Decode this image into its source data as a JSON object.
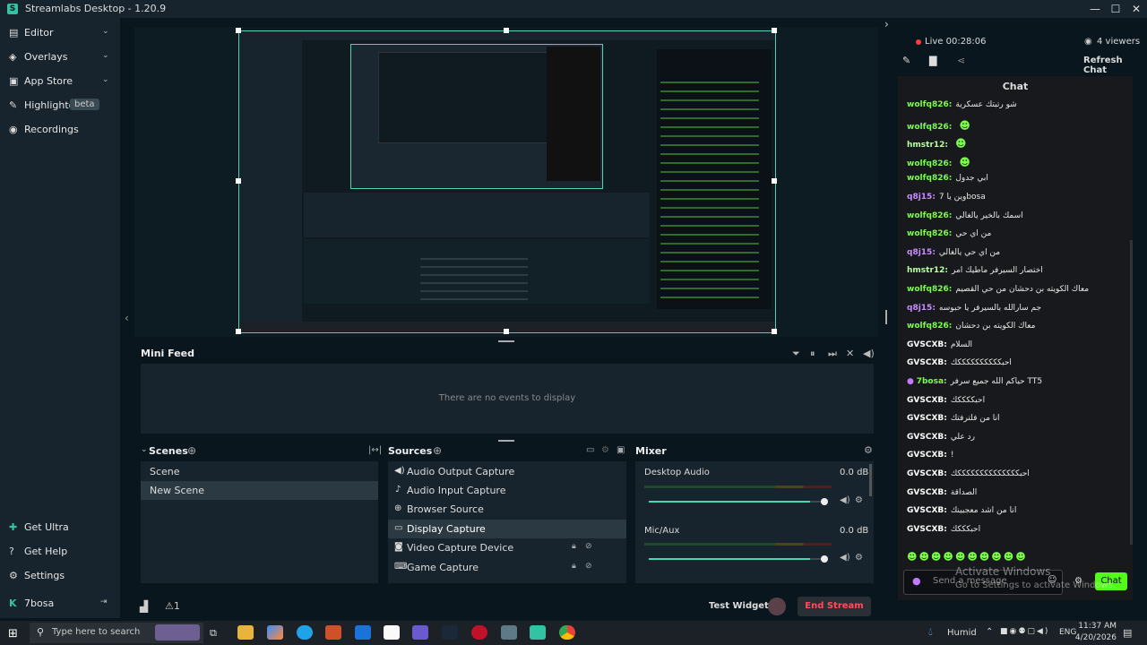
{
  "app": {
    "title": "Streamlabs Desktop - 1.20.9",
    "logo": "streamlabs-logo"
  },
  "window_controls": {
    "minimize": "—",
    "maximize": "☐",
    "close": "✕"
  },
  "sidebar": {
    "items": [
      {
        "label": "Editor",
        "icon": "editor-icon"
      },
      {
        "label": "Overlays",
        "icon": "overlays-icon"
      },
      {
        "label": "App Store",
        "icon": "app-store-icon"
      },
      {
        "label": "Highlighter",
        "icon": "highlighter-icon",
        "badge": "beta"
      },
      {
        "label": "Recordings",
        "icon": "recordings-icon"
      }
    ],
    "bottom": [
      {
        "label": "Get Ultra"
      },
      {
        "label": "Get Help"
      },
      {
        "label": "Settings"
      },
      {
        "label": "7bosa"
      }
    ]
  },
  "mini_feed": {
    "title": "Mini Feed",
    "empty": "There are no events to display"
  },
  "scenes": {
    "title": "Scenes",
    "items": [
      "Scene",
      "New Scene"
    ],
    "selected": "New Scene"
  },
  "sources": {
    "title": "Sources",
    "items": [
      "Audio Output Capture",
      "Audio Input Capture",
      "Browser Source",
      "Display Capture",
      "Video Capture Device",
      "Game Capture"
    ],
    "selected": "Display Capture"
  },
  "mixer": {
    "title": "Mixer",
    "channels": [
      {
        "name": "Desktop Audio",
        "db": "0.0 dB",
        "level": 0.92
      },
      {
        "name": "Mic/Aux",
        "db": "0.0 dB",
        "level": 0.92
      }
    ]
  },
  "footer": {
    "test_widgets": "Test Widgets",
    "end_stream": "End Stream"
  },
  "stream_info": {
    "live": "Live 00:28:06",
    "viewers": "4 viewers",
    "refresh": "Refresh Chat"
  },
  "chat": {
    "title": "Chat",
    "messages": [
      {
        "user": "wolfq826:",
        "text": "شو رتبتك عسكرية",
        "color": "#7cfc4a"
      },
      {
        "user": "wolfq826:",
        "text": "",
        "color": "#7cfc4a",
        "emote": true
      },
      {
        "user": "hmstr12:",
        "text": "",
        "color": "#b7ff9d",
        "emote": true
      },
      {
        "user": "wolfq826:",
        "text": "",
        "color": "#7cfc4a",
        "emote": true
      },
      {
        "user": "wolfq826:",
        "text": "ابي جدول",
        "color": "#7cfc4a"
      },
      {
        "user": "q8j15:",
        "text": "وين يا 7bosa",
        "color": "#c98cff"
      },
      {
        "user": "wolfq826:",
        "text": "اسمك بالخير يالغالي",
        "color": "#7cfc4a"
      },
      {
        "user": "wolfq826:",
        "text": "من اي حي",
        "color": "#7cfc4a"
      },
      {
        "user": "q8j15:",
        "text": "من اي حي يالغالي",
        "color": "#c98cff"
      },
      {
        "user": "hmstr12:",
        "text": "اختصار السيرفر ماطيك امر",
        "color": "#b7ff9d"
      },
      {
        "user": "wolfq826:",
        "text": "معاك الكويته بن دحشان من حي القصيم",
        "color": "#7cfc4a"
      },
      {
        "user": "q8j15:",
        "text": "جم سارالله بالسيرفر يا حبوسه",
        "color": "#c98cff"
      },
      {
        "user": "wolfq826:",
        "text": "معاك الكويته بن دحشان",
        "color": "#7cfc4a"
      },
      {
        "user": "GVSCXB:",
        "text": "السلام",
        "color": "#ffffff"
      },
      {
        "user": "GVSCXB:",
        "text": "احبككككككككككك",
        "color": "#ffffff"
      },
      {
        "user": "7bosa:",
        "text": "حياكم الله جميع سرفر TT5",
        "color": "#7cfc4a",
        "mic": true
      },
      {
        "user": "GVSCXB:",
        "text": "احبككككك",
        "color": "#ffffff"
      },
      {
        "user": "GVSCXB:",
        "text": "انا من فلترفتك",
        "color": "#ffffff"
      },
      {
        "user": "GVSCXB:",
        "text": "رد علي",
        "color": "#ffffff"
      },
      {
        "user": "GVSCXB:",
        "text": "!",
        "color": "#ffffff"
      },
      {
        "user": "GVSCXB:",
        "text": "احبككككككككككككككك",
        "color": "#ffffff"
      },
      {
        "user": "GVSCXB:",
        "text": "الصداقة",
        "color": "#ffffff"
      },
      {
        "user": "GVSCXB:",
        "text": "انا من اشد معجبينك",
        "color": "#ffffff"
      },
      {
        "user": "GVSCXB:",
        "text": "احبكككك",
        "color": "#ffffff"
      }
    ],
    "input_placeholder": "Send a message",
    "send_label": "Chat",
    "activate_title": "Activate Windows",
    "activate_sub": "Go to Settings to activate Windows."
  },
  "taskbar": {
    "search_placeholder": "Type here to search",
    "weather": "Humid",
    "lang": "ENG",
    "time": "11:37 AM",
    "date": "4/20/2026"
  },
  "colors": {
    "accent": "#31c3a2",
    "live": "#ff3b3b",
    "end_stream": "#ff4d5a",
    "background": "#09161d",
    "panel": "#17242d"
  }
}
